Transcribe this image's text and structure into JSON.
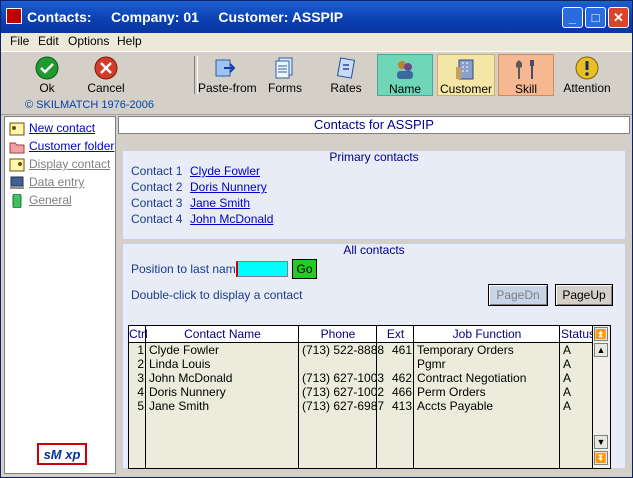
{
  "window": {
    "title": "Contacts:     Company: 01     Customer: ASSPIP",
    "controls": {
      "minimize": "_",
      "maximize": "□",
      "close": "✕"
    }
  },
  "menu": [
    "File",
    "Edit",
    "Options",
    "Help"
  ],
  "toolbar": {
    "ok": "Ok",
    "cancel": "Cancel",
    "paste_from": "Paste-from",
    "forms": "Forms",
    "rates": "Rates",
    "name": "Name",
    "customer": "Customer",
    "skill": "Skill",
    "attention": "Attention"
  },
  "brand": "© SKILMATCH 1976-2006",
  "sidebar": {
    "items": [
      {
        "label": "New contact",
        "state": "active",
        "icon": "new-contact-icon"
      },
      {
        "label": "Customer folder",
        "state": "active",
        "icon": "folder-icon"
      },
      {
        "label": "Display contact",
        "state": "disabled",
        "icon": "display-contact-icon"
      },
      {
        "label": "Data entry",
        "state": "disabled",
        "icon": "data-entry-icon"
      },
      {
        "label": "General",
        "state": "disabled",
        "icon": "general-icon"
      }
    ],
    "logo_text": "sM xp"
  },
  "main": {
    "title": "Contacts for ASSPIP",
    "primary": {
      "legend": "Primary contacts",
      "contacts": [
        {
          "label": "Contact 1",
          "name": "Clyde Fowler"
        },
        {
          "label": "Contact 2",
          "name": "Doris Nunnery"
        },
        {
          "label": "Contact 3",
          "name": "Jane Smith"
        },
        {
          "label": "Contact 4",
          "name": "John McDonald"
        }
      ]
    },
    "all": {
      "legend": "All contacts",
      "position_label": "Position to last name",
      "position_value": "",
      "go": "Go",
      "hint": "Double-click to display a contact",
      "pagedn": "PageDn",
      "pageup": "PageUp",
      "columns": [
        "Ctrl",
        "Contact Name",
        "Phone",
        "Ext",
        "Job Function",
        "Status"
      ],
      "rows": [
        {
          "ctrl": "1",
          "name": "Clyde Fowler",
          "phone": "(713) 522-8888",
          "ext": "461",
          "job": "Temporary Orders",
          "status": "A"
        },
        {
          "ctrl": "2",
          "name": "Linda Louis",
          "phone": "",
          "ext": "",
          "job": "Pgmr",
          "status": "A"
        },
        {
          "ctrl": "3",
          "name": "John McDonald",
          "phone": "(713) 627-1003",
          "ext": "462",
          "job": "Contract Negotiation",
          "status": "A"
        },
        {
          "ctrl": "4",
          "name": "Doris Nunnery",
          "phone": "(713) 627-1002",
          "ext": "466",
          "job": "Perm Orders",
          "status": "A"
        },
        {
          "ctrl": "5",
          "name": "Jane Smith",
          "phone": "(713) 627-6987",
          "ext": "413",
          "job": "Accts Payable",
          "status": "A"
        }
      ]
    }
  },
  "colors": {
    "titlebar": "#0a3fb0",
    "link": "#0000cc",
    "heading": "#000080",
    "go_button": "#22cc22",
    "position_input": "#00ffff"
  }
}
